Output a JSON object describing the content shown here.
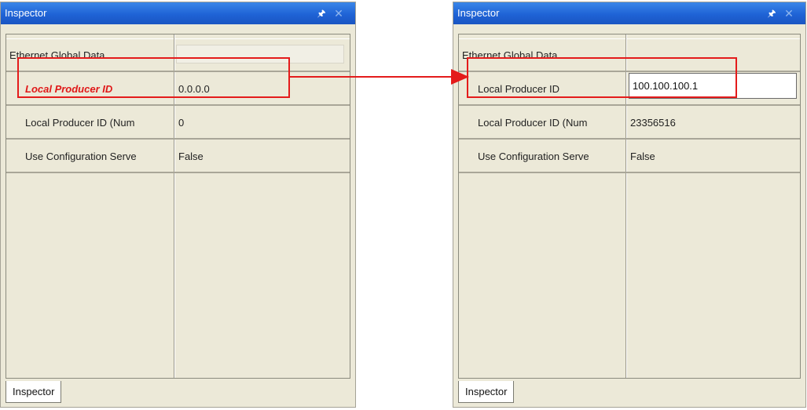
{
  "left_panel": {
    "title": "Inspector",
    "pin_icon": "pin-icon",
    "close_icon": "close-icon",
    "rows": [
      {
        "name": "Ethernet Global Data",
        "value": ""
      },
      {
        "name": "Local Producer ID",
        "value": "0.0.0.0"
      },
      {
        "name": "Local Producer ID (Num",
        "value": "0"
      },
      {
        "name": "Use Configuration Serve",
        "value": "False"
      }
    ],
    "tab_label": "Inspector"
  },
  "right_panel": {
    "title": "Inspector",
    "pin_icon": "pin-icon",
    "close_icon": "close-icon",
    "rows": [
      {
        "name": "Ethernet Global Data",
        "value": ""
      },
      {
        "name": "Local Producer ID",
        "value": "100.100.100.1"
      },
      {
        "name": "Local Producer ID (Num",
        "value": "23356516"
      },
      {
        "name": "Use Configuration Serve",
        "value": "False"
      }
    ],
    "tab_label": "Inspector"
  },
  "annotation": {
    "highlight_color": "#e41b1b",
    "arrow_color": "#e41b1b",
    "arrow_icon": "arrow-right-icon"
  },
  "colors": {
    "titlebar": "#1f63d6",
    "panel_bg": "#ece9d8",
    "emphasis_text": "#e01818"
  }
}
